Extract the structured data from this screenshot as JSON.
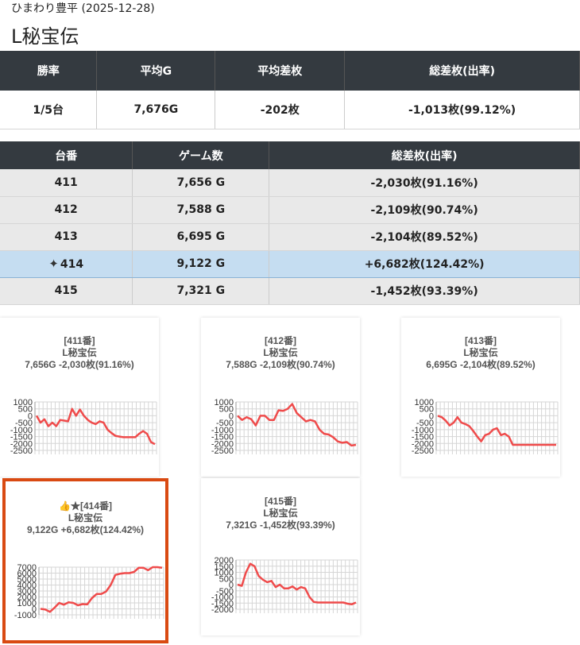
{
  "breadcrumb": "ひまわり豊平 (2025-12-28)",
  "title": "L秘宝伝",
  "summary": {
    "headers": [
      "勝率",
      "平均G",
      "平均差枚",
      "総差枚(出率)"
    ],
    "values": [
      "1/5台",
      "7,676G",
      "-202枚",
      "-1,013枚(99.12%)"
    ]
  },
  "machines": {
    "headers": [
      "台番",
      "ゲーム数",
      "総差枚(出率)"
    ],
    "rows": [
      {
        "id": "411",
        "games": "7,656 G",
        "diff": "-2,030枚(91.16%)"
      },
      {
        "id": "412",
        "games": "7,588 G",
        "diff": "-2,109枚(90.74%)"
      },
      {
        "id": "413",
        "games": "6,695 G",
        "diff": "-2,104枚(89.52%)"
      },
      {
        "id": "414",
        "games": "9,122 G",
        "diff": "+6,682枚(124.42%)"
      },
      {
        "id": "415",
        "games": "7,321 G",
        "diff": "-1,452枚(93.39%)"
      }
    ]
  },
  "colors": {
    "line": "#ef4b4b",
    "highlight": "#c5ddf1",
    "header_bg": "#343a40",
    "selected_border": "#d94a12"
  },
  "charts": [
    {
      "label": "[411番]",
      "name": "L秘宝伝",
      "stats": "7,656G -2,030枚(91.16%)",
      "ymin": -2500,
      "ymax": 1000,
      "ticks": [
        "1000",
        "500",
        "0",
        "-500",
        "-1000",
        "-1500",
        "-2000",
        "-2500"
      ],
      "values": [
        0,
        -500,
        -250,
        -750,
        -500,
        -750,
        -300,
        -350,
        -400,
        500,
        0,
        450,
        0,
        -300,
        -500,
        -600,
        -400,
        -500,
        -1000,
        -1250,
        -1450,
        -1500,
        -1550,
        -1550,
        -1550,
        -1550,
        -1300,
        -1100,
        -1300,
        -1900,
        -2050
      ]
    },
    {
      "label": "[412番]",
      "name": "L秘宝伝",
      "stats": "7,588G -2,109枚(90.74%)",
      "ymin": -2500,
      "ymax": 1000,
      "ticks": [
        "1000",
        "500",
        "0",
        "-500",
        "-1000",
        "-1500",
        "-2000",
        "-2500"
      ],
      "values": [
        0,
        -300,
        -100,
        -250,
        -700,
        0,
        0,
        -300,
        -300,
        400,
        350,
        500,
        850,
        200,
        -100,
        -400,
        -300,
        -400,
        -1000,
        -1300,
        -1350,
        -1550,
        -1850,
        -1950,
        -1900,
        -2150,
        -2100
      ]
    },
    {
      "label": "[413番]",
      "name": "L秘宝伝",
      "stats": "6,695G -2,104枚(89.52%)",
      "ymin": -2500,
      "ymax": 1000,
      "ticks": [
        "1000",
        "500",
        "0",
        "-500",
        "-1000",
        "-1500",
        "-2000",
        "-2500"
      ],
      "values": [
        0,
        -100,
        -350,
        -700,
        -500,
        -100,
        -500,
        -600,
        -750,
        -1100,
        -1500,
        -1850,
        -1400,
        -1300,
        -1000,
        -900,
        -1400,
        -1300,
        -1500,
        -2100,
        -2100,
        -2100,
        -2100,
        -2100,
        -2100,
        -2100,
        -2100,
        -2100,
        -2100,
        -2100,
        -2100
      ]
    },
    {
      "label": "[414番]",
      "name": "L秘宝伝",
      "stats": "9,122G +6,682枚(124.42%)",
      "prefix": "👍★",
      "ymin": -1000,
      "ymax": 7000,
      "ticks": [
        "7000",
        "6000",
        "5000",
        "4000",
        "3000",
        "2000",
        "1000",
        "0",
        "-1000"
      ],
      "values": [
        0,
        -100,
        -500,
        200,
        1000,
        700,
        1100,
        1000,
        600,
        800,
        750,
        1800,
        2500,
        2500,
        2900,
        4000,
        5700,
        5900,
        6000,
        6000,
        6200,
        6900,
        6900,
        6500,
        7000,
        7000,
        6900
      ]
    },
    {
      "label": "[415番]",
      "name": "L秘宝伝",
      "stats": "7,321G -1,452枚(93.39%)",
      "ymin": -2000,
      "ymax": 2000,
      "ticks": [
        "2000",
        "1500",
        "1000",
        "500",
        "0",
        "-500",
        "-1000",
        "-1500",
        "-2000"
      ],
      "values": [
        0,
        -100,
        1000,
        1700,
        1500,
        700,
        400,
        200,
        300,
        -200,
        0,
        -300,
        -300,
        -150,
        -400,
        -200,
        -300,
        -1000,
        -1400,
        -1450,
        -1450,
        -1450,
        -1450,
        -1450,
        -1450,
        -1450,
        -1550,
        -1600,
        -1450
      ]
    }
  ]
}
